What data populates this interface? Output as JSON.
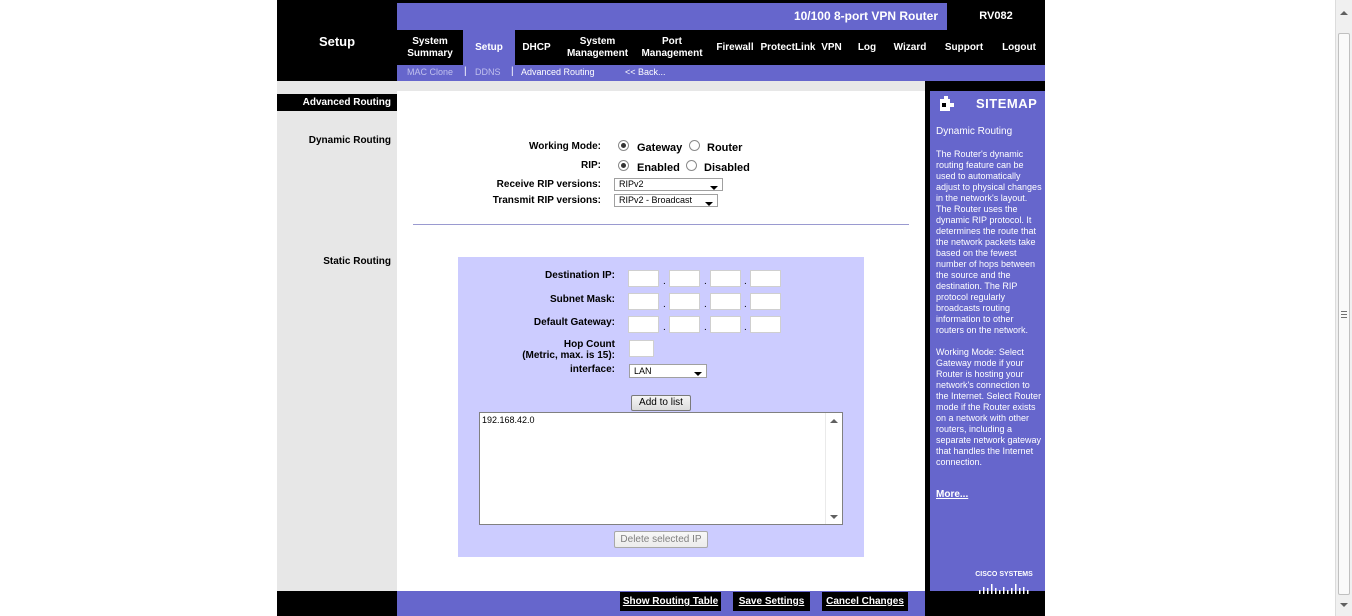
{
  "header": {
    "section_title": "Setup",
    "product_name": "10/100 8-port VPN Router",
    "model": "RV082"
  },
  "nav": {
    "items": [
      {
        "label_line1": "System",
        "label_line2": "Summary"
      },
      {
        "label_line1": "Setup",
        "label_line2": ""
      },
      {
        "label_line1": "DHCP",
        "label_line2": ""
      },
      {
        "label_line1": "System",
        "label_line2": "Management"
      },
      {
        "label_line1": "Port",
        "label_line2": "Management"
      },
      {
        "label_line1": "Firewall",
        "label_line2": ""
      },
      {
        "label_line1": "ProtectLink",
        "label_line2": ""
      },
      {
        "label_line1": "VPN",
        "label_line2": ""
      },
      {
        "label_line1": "Log",
        "label_line2": ""
      },
      {
        "label_line1": "Wizard",
        "label_line2": ""
      },
      {
        "label_line1": "Support",
        "label_line2": ""
      },
      {
        "label_line1": "Logout",
        "label_line2": ""
      }
    ],
    "active": "Setup"
  },
  "subnav": {
    "items": [
      "MAC Clone",
      "DDNS",
      "Advanced Routing",
      "<< Back..."
    ]
  },
  "left": {
    "page_heading": "Advanced Routing",
    "dynamic_label": "Dynamic Routing",
    "static_label": "Static Routing"
  },
  "dynamic": {
    "working_mode_label": "Working Mode:",
    "gateway_label": "Gateway",
    "router_label": "Router",
    "working_mode_value": "Gateway",
    "rip_label": "RIP:",
    "enabled_label": "Enabled",
    "disabled_label": "Disabled",
    "rip_value": "Enabled",
    "receive_label": "Receive RIP versions:",
    "receive_value": "RIPv2",
    "transmit_label": "Transmit RIP versions:",
    "transmit_value": "RIPv2 - Broadcast"
  },
  "static": {
    "dest_ip_label": "Destination IP:",
    "subnet_label": "Subnet Mask:",
    "gateway_label": "Default Gateway:",
    "hop_label_line1": "Hop Count",
    "hop_label_line2": "(Metric, max. is 15):",
    "interface_label": "interface:",
    "interface_value": "LAN",
    "add_button": "Add to list",
    "entries": [
      "192.168.42.0"
    ],
    "delete_button": "Delete selected IP"
  },
  "footer": {
    "show_table": "Show Routing Table",
    "save": "Save Settings",
    "cancel": "Cancel Changes"
  },
  "sitemap": {
    "title": "SITEMAP",
    "heading": "Dynamic Routing",
    "paragraph1": "The Router's dynamic routing feature can be used to automatically adjust to physical changes in the network's layout. The Router uses the dynamic RIP protocol. It determines the route that the network packets take based on the fewest number of hops between the source and the destination. The RIP protocol regularly broadcasts routing information to other routers on the network.",
    "paragraph2": "Working Mode: Select Gateway mode if your Router is hosting your network's connection to the Internet. Select Router mode if the Router exists on a network with other routers, including a separate network gateway that handles the Internet connection.",
    "more": "More...",
    "logo_text": "Cisco Systems"
  },
  "colors": {
    "brand_purple": "#6666cc",
    "panel_lilac": "#ccccff",
    "black": "#000000",
    "gray_bg": "#e7e7e7"
  }
}
